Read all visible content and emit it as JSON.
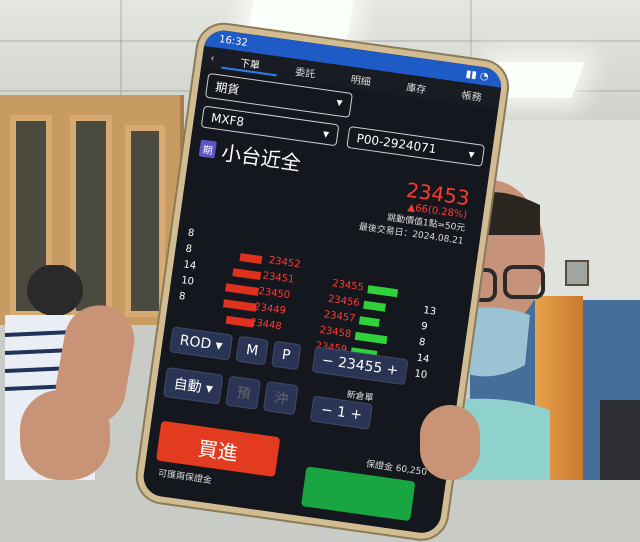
{
  "status": {
    "time": "16:32"
  },
  "tabs": [
    "下單",
    "委託",
    "明細",
    "庫存",
    "帳務"
  ],
  "product_type": "期貨",
  "symbol": "MXF8",
  "account": "P00-2924071",
  "tag": "期",
  "instrument_name": "小台近全",
  "last_price": "23453",
  "change": "▲66(0.28%)",
  "tick_info": "跳動價值1點=50元",
  "last_trade_date": "最後交易日：2024.08.21",
  "bid_sizes": [
    "8",
    "14",
    "10",
    "8"
  ],
  "bid_prices": [
    "23452",
    "23451",
    "23450",
    "23449",
    "23448"
  ],
  "ask_prices": [
    "23455",
    "23456",
    "23457",
    "23458",
    "23459"
  ],
  "ask_sizes": [
    "13",
    "9",
    "8",
    "14",
    "10"
  ],
  "left_sizes_top": "8",
  "order_type": "ROD",
  "mode_m": "M",
  "mode_p": "P",
  "price_input": "23455",
  "auto_label": "自動",
  "pre_label": "預",
  "flat_label": "沖",
  "qty_label": "新倉單",
  "qty_input": "1",
  "buy_label": "買進",
  "margin": "保證金 60,250",
  "footer_left": "可匯兩保證金"
}
